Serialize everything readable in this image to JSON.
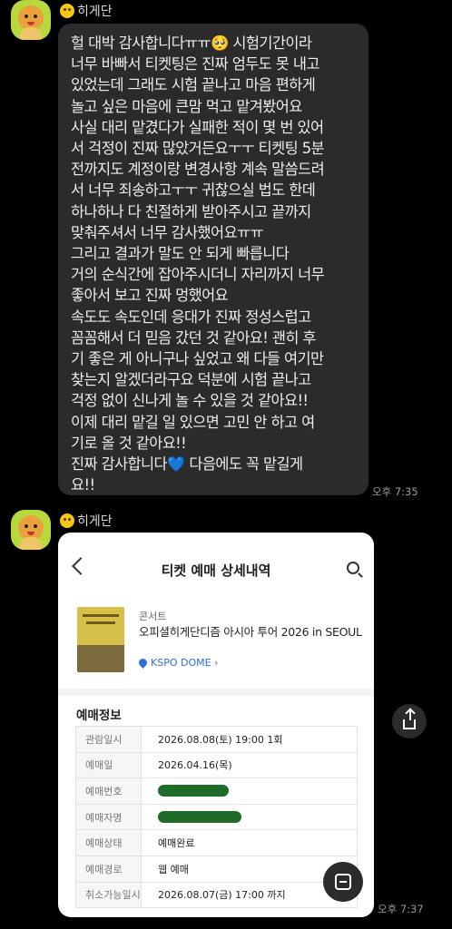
{
  "message1": {
    "sender": "히게단",
    "text": "헐 대박 감사합니다ㅠㅠ🥺 시험기간이라\n너무 바빠서 티켓팅은 진짜 엄두도 못 내고\n있었는데 그래도 시험 끝나고 마음 편하게\n놀고 싶은 마음에 큰맘 먹고 맡겨봤어요\n사실 대리 맡겼다가 실패한 적이 몇 번 있어\n서 걱정이 진짜 많았거든요ㅜㅜ 티켓팅 5분\n전까지도 계정이랑 변경사항 계속 말씀드려\n서 너무 죄송하고ㅜㅜ 귀찮으실 법도 한데\n하나하나 다 친절하게 받아주시고 끝까지\n맞춰주셔서 너무 감사했어요ㅠㅠ\n그리고 결과가 말도 안 되게 빠릅니다\n거의 순식간에 잡아주시더니 자리까지 너무\n좋아서 보고 진짜 멍했어요\n속도도 속도인데 응대가 진짜 정성스럽고\n꼼꼼해서 더 믿음 갔던 것 같아요! 괜히 후\n기 좋은 게 아니구나 싶었고 왜 다들 여기만\n찾는지 알겠더라구요 덕분에 시험 끝나고\n걱정 없이 신나게 놀 수 있을 것 같아요!!\n이제 대리 맡길 일 있으면 고민 안 하고 여\n기로 올 것 같아요!!\n진짜 감사합니다💙 다음에도 꼭 맡길게\n요!!",
    "time": "오후 7:35"
  },
  "message2": {
    "sender": "히게단",
    "time": "오후 7:37"
  },
  "ticket": {
    "title": "티켓 예매 상세내역",
    "category": "콘서트",
    "event_name": "오피셜히게단디즘 아시아 투어 2026 in SEOUL",
    "venue": "KSPO DOME ›",
    "section_title": "예매정보",
    "rows": [
      {
        "label": "관람일시",
        "value": "2026.08.08(토) 19:00 1회"
      },
      {
        "label": "예매일",
        "value": "2026.04.16(목)"
      },
      {
        "label": "예매번호",
        "value": ""
      },
      {
        "label": "예매자명",
        "value": ""
      },
      {
        "label": "예매상태",
        "value": "예매완료"
      },
      {
        "label": "예매경로",
        "value": "웹 예매"
      },
      {
        "label": "취소가능일시",
        "value": "2026.08.07(금) 17:00 까지"
      }
    ]
  },
  "colors": {
    "background": "#000000",
    "bubble": "#2b2b2b",
    "venue_link": "#2d6fd8"
  },
  "icons": [
    "back-icon",
    "search-icon",
    "share-icon",
    "scan-icon",
    "location-pin-icon"
  ]
}
